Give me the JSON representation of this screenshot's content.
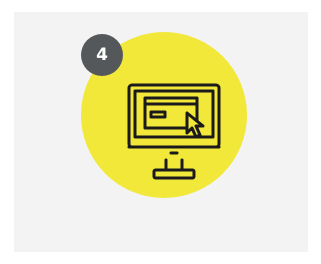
{
  "step": {
    "number": "4",
    "icon": "computer-monitor-with-cursor-icon"
  },
  "colors": {
    "card_background": "#f3f3f3",
    "circle": "#f1e83a",
    "badge": "#54585a",
    "badge_text": "#ffffff",
    "icon_stroke": "#1a1a1a"
  }
}
